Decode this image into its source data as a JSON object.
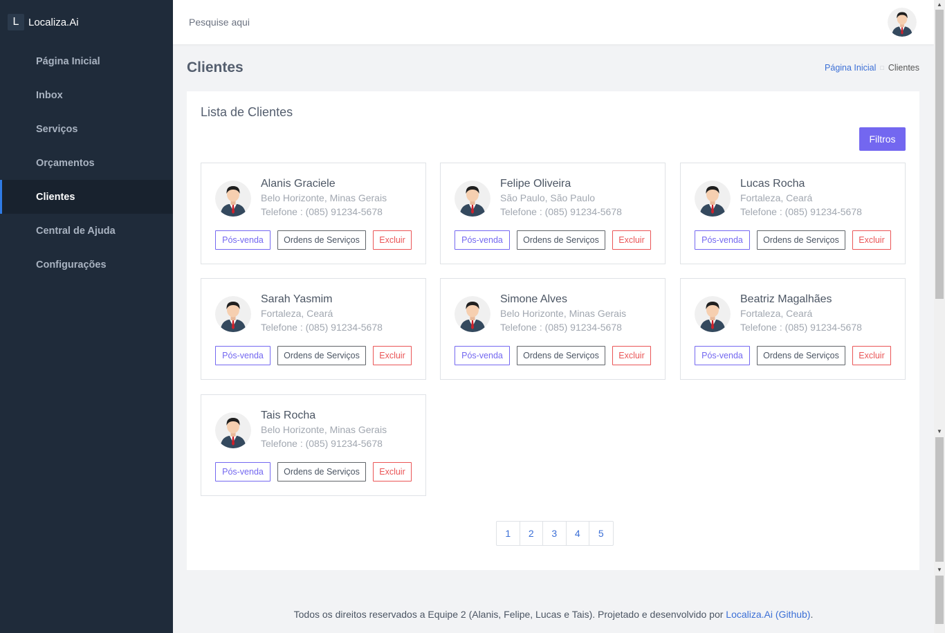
{
  "app": {
    "logo_letter": "L",
    "name": "Localiza.Ai"
  },
  "sidebar": {
    "items": [
      {
        "label": "Página Inicial",
        "active": false
      },
      {
        "label": "Inbox",
        "active": false
      },
      {
        "label": "Serviços",
        "active": false
      },
      {
        "label": "Orçamentos",
        "active": false
      },
      {
        "label": "Clientes",
        "active": true
      },
      {
        "label": "Central de Ajuda",
        "active": false
      },
      {
        "label": "Configurações",
        "active": false
      }
    ]
  },
  "topbar": {
    "search_placeholder": "Pesquise aqui",
    "avatar_icon": "user-avatar-icon"
  },
  "page": {
    "title": "Clientes",
    "breadcrumb": {
      "home": "Página Inicial",
      "current": "Clientes"
    }
  },
  "list": {
    "title": "Lista de Clientes",
    "filter_label": "Filtros",
    "button_labels": {
      "pos_venda": "Pós-venda",
      "ordens": "Ordens de Serviços",
      "excluir": "Excluir"
    },
    "clients": [
      {
        "name": "Alanis Graciele",
        "city": "Belo Horizonte, Minas Gerais",
        "phone": "Telefone : (085) 91234-5678"
      },
      {
        "name": "Felipe Oliveira",
        "city": "São Paulo, São Paulo",
        "phone": "Telefone : (085) 91234-5678"
      },
      {
        "name": "Lucas Rocha",
        "city": "Fortaleza, Ceará",
        "phone": "Telefone : (085) 91234-5678"
      },
      {
        "name": "Sarah Yasmim",
        "city": "Fortaleza, Ceará",
        "phone": "Telefone : (085) 91234-5678"
      },
      {
        "name": "Simone Alves",
        "city": "Belo Horizonte, Minas Gerais",
        "phone": "Telefone : (085) 91234-5678"
      },
      {
        "name": "Beatriz Magalhães",
        "city": "Fortaleza, Ceará",
        "phone": "Telefone : (085) 91234-5678"
      },
      {
        "name": "Tais Rocha",
        "city": "Belo Horizonte, Minas Gerais",
        "phone": "Telefone : (085) 91234-5678"
      }
    ],
    "pagination": [
      "1",
      "2",
      "3",
      "4",
      "5"
    ]
  },
  "footer": {
    "text": "Todos os direitos reservados a Equipe 2 (Alanis, Felipe, Lucas e Tais). Projetado e desenvolvido por ",
    "link": "Localiza.Ai (Github)",
    "end": "."
  },
  "colors": {
    "sidebar_bg": "#1f2b3a",
    "accent": "#7367f0",
    "danger": "#ea5455",
    "link": "#3b6fd6"
  }
}
